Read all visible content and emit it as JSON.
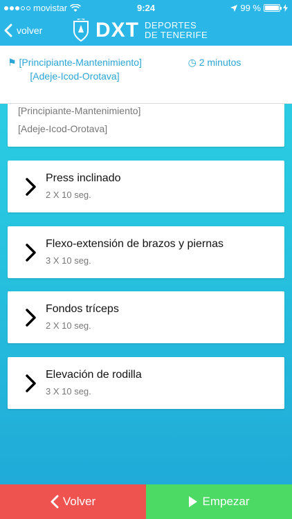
{
  "status_bar": {
    "carrier": "movistar",
    "time": "9:24",
    "battery": "99 %",
    "battery_level": 0.99
  },
  "nav": {
    "back_label": "volver",
    "logo_letters": "DXT",
    "logo_line1": "DEPORTES",
    "logo_line2": "DE TENERIFE"
  },
  "info": {
    "level_text": "[Principiante-Mantenimiento][Adeje-Icod-Orotava]",
    "duration_text": "2 minutos"
  },
  "summary": {
    "line1": "[Principiante-Mantenimiento]",
    "line2": "[Adeje-Icod-Orotava]"
  },
  "exercises": [
    {
      "name": "Press inclinado",
      "reps": "2 X 10 seg."
    },
    {
      "name": "Flexo-extensión de brazos y piernas",
      "reps": "3 X 10 seg."
    },
    {
      "name": "Fondos tríceps",
      "reps": "2 X 10 seg."
    },
    {
      "name": "Elevación de rodilla",
      "reps": "3 X 10 seg."
    }
  ],
  "buttons": {
    "back_label": "Volver",
    "start_label": "Empezar"
  },
  "colors": {
    "accent": "#2bb6e8",
    "back_button": "#ef5350",
    "start_button": "#4cd964"
  }
}
